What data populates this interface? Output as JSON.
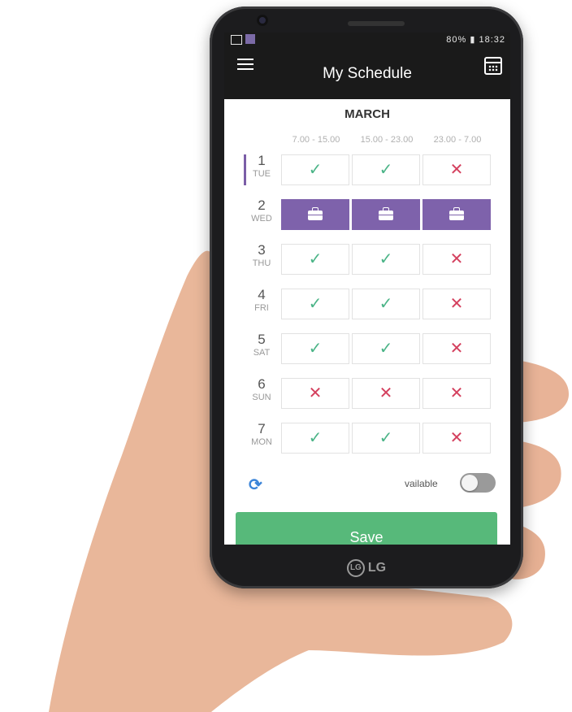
{
  "status_bar": {
    "right_text": "80% ▮ 18:32"
  },
  "app_bar": {
    "title": "My Schedule"
  },
  "schedule": {
    "month": "MARCH",
    "shifts": [
      "7.00 - 15.00",
      "15.00 - 23.00",
      "23.00 - 7.00"
    ],
    "days": [
      {
        "num": "1",
        "name": "TUE",
        "selected": true,
        "cells": [
          "yes",
          "yes",
          "no"
        ]
      },
      {
        "num": "2",
        "name": "WED",
        "selected": false,
        "cells": [
          "work",
          "work",
          "work"
        ]
      },
      {
        "num": "3",
        "name": "THU",
        "selected": false,
        "cells": [
          "yes",
          "yes",
          "no"
        ]
      },
      {
        "num": "4",
        "name": "FRI",
        "selected": false,
        "cells": [
          "yes",
          "yes",
          "no"
        ]
      },
      {
        "num": "5",
        "name": "SAT",
        "selected": false,
        "cells": [
          "yes",
          "yes",
          "no"
        ]
      },
      {
        "num": "6",
        "name": "SUN",
        "selected": false,
        "cells": [
          "no",
          "no",
          "no"
        ]
      },
      {
        "num": "7",
        "name": "MON",
        "selected": false,
        "cells": [
          "yes",
          "yes",
          "no"
        ]
      }
    ],
    "symbols": {
      "yes": "✓",
      "no": "✕"
    }
  },
  "footer": {
    "available_label": "vailable",
    "available_toggle": false,
    "save_label": "Save"
  },
  "device": {
    "brand": "LG"
  },
  "colors": {
    "accent": "#7e62ab",
    "check": "#4bb487",
    "cross": "#d4405e",
    "save": "#57b97a"
  }
}
